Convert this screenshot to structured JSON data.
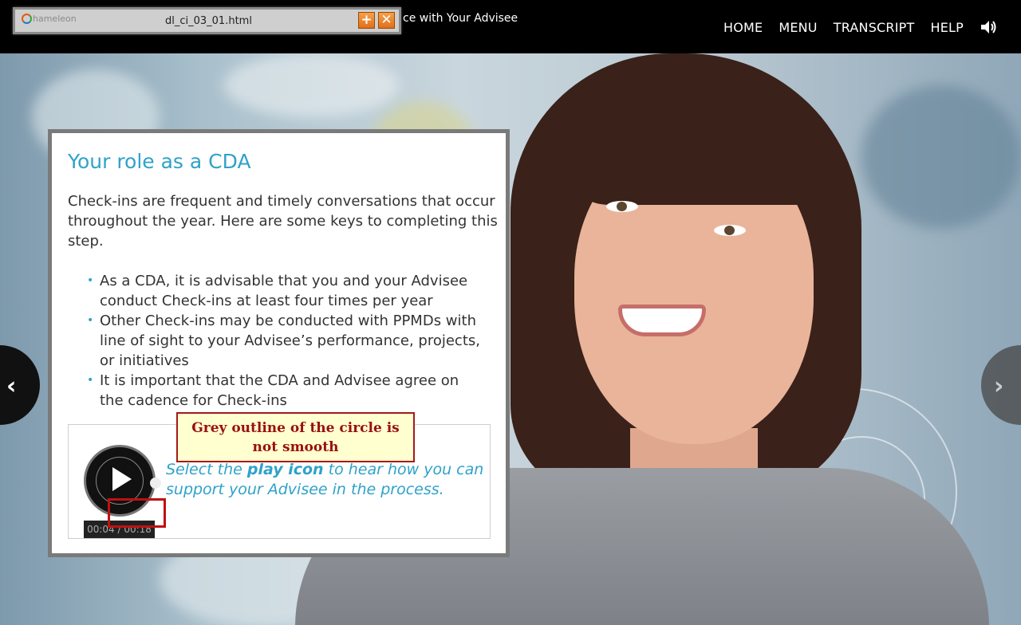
{
  "header": {
    "course_title": "ce with Your Advisee",
    "nav": [
      "HOME",
      "MENU",
      "TRANSCRIPT",
      "HELP"
    ],
    "sound_icon": "speaker-icon"
  },
  "toolbar": {
    "logo_text": "hameleon",
    "filename": "dl_ci_03_01.html",
    "plus_label": "+",
    "close_label": "✕"
  },
  "panel": {
    "title": "Your role as a CDA",
    "intro": "Check-ins are frequent and timely conversations that occur throughout the year. Here are some keys to completing this step.",
    "bullets": [
      "As a CDA, it is advisable that you and your Advisee conduct Check-ins at least four times per year",
      "Other Check-ins may be conducted with PPMDs with line of sight to your Advisee’s performance, projects, or initiatives",
      "It is important that the CDA and Advisee agree on the cadence for Check-ins"
    ]
  },
  "audio": {
    "prompt_pre": "Select the ",
    "prompt_bold": "play icon",
    "prompt_post": " to hear how you can support your Advisee in the process.",
    "time": "00:04 / 00:18"
  },
  "annotation": {
    "text": "Grey outline of the circle is not smooth"
  },
  "nav_arrows": {
    "prev": "‹",
    "next": "›"
  }
}
